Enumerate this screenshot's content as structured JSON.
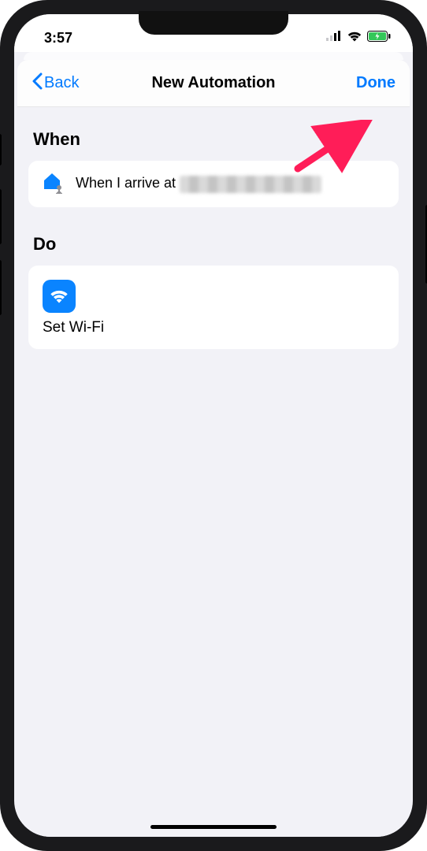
{
  "status": {
    "time": "3:57"
  },
  "navbar": {
    "back_label": "Back",
    "title": "New Automation",
    "done_label": "Done"
  },
  "sections": {
    "when": {
      "header": "When",
      "trigger_text": "When I arrive at "
    },
    "do": {
      "header": "Do",
      "action_label": "Set Wi-Fi"
    }
  },
  "colors": {
    "accent": "#007aff",
    "bg": "#f2f2f7"
  }
}
